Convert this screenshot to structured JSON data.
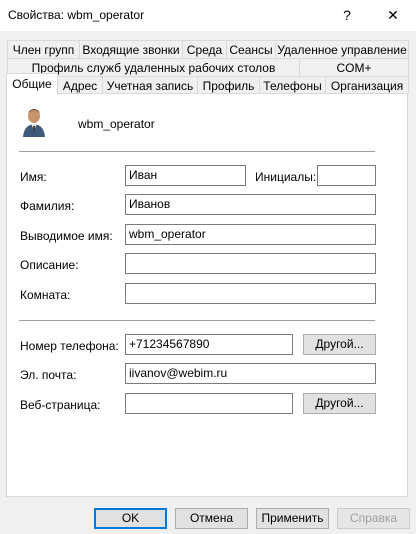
{
  "window": {
    "title": "Свойства: wbm_operator",
    "help_glyph": "?",
    "close_glyph": "✕"
  },
  "tabs_row1": [
    "Член групп",
    "Входящие звонки",
    "Среда",
    "Сеансы",
    "Удаленное управление"
  ],
  "tabs_row2": [
    "Профиль служб удаленных рабочих столов",
    "COM+"
  ],
  "tabs_row3": [
    "Общие",
    "Адрес",
    "Учетная запись",
    "Профиль",
    "Телефоны",
    "Организация"
  ],
  "general": {
    "display_name": "wbm_operator",
    "fields": {
      "first_name_label": "Имя:",
      "first_name_value": "Иван",
      "initials_label": "Инициалы:",
      "initials_value": "",
      "last_name_label": "Фамилия:",
      "last_name_value": "Иванов",
      "display_label": "Выводимое имя:",
      "display_value": "wbm_operator",
      "description_label": "Описание:",
      "description_value": "",
      "office_label": "Комната:",
      "office_value": "",
      "phone_label": "Номер телефона:",
      "phone_value": "+71234567890",
      "email_label": "Эл. почта:",
      "email_value": "iivanov@webim.ru",
      "web_label": "Веб-страница:",
      "web_value": ""
    },
    "other_button": "Другой..."
  },
  "footer": {
    "ok": "OK",
    "cancel": "Отмена",
    "apply": "Применить",
    "help": "Справка"
  },
  "icons": {
    "user": "user-avatar-icon"
  }
}
